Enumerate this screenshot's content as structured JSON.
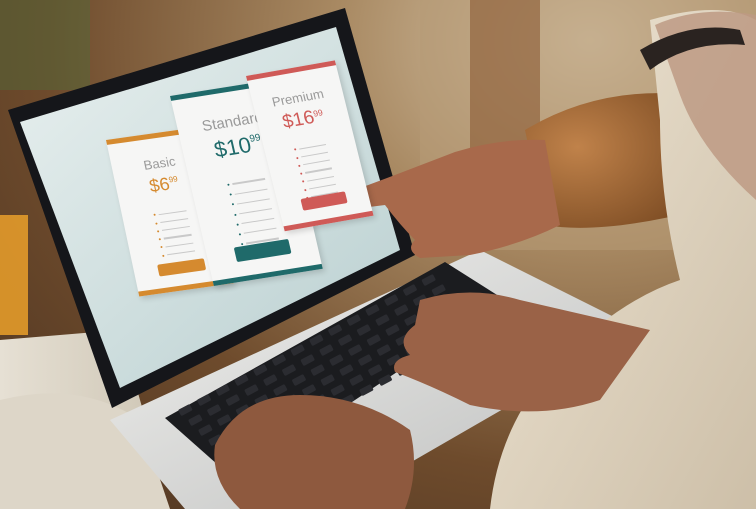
{
  "pricing_page": {
    "plans": [
      {
        "name": "Basic",
        "price": "$6",
        "cents": "99",
        "accent": "#d58a2f"
      },
      {
        "name": "Standard",
        "price": "$10",
        "cents": "99",
        "accent": "#1f6a6a"
      },
      {
        "name": "Premium",
        "price": "$16",
        "cents": "99",
        "accent": "#cf5a57"
      }
    ]
  },
  "colors": {
    "screen_bg": "#cfdddd",
    "laptop_body": "#d8d9d8",
    "keyboard": "#1b1c1f",
    "sweater": "#a5692e",
    "skin": "#9a6247"
  }
}
